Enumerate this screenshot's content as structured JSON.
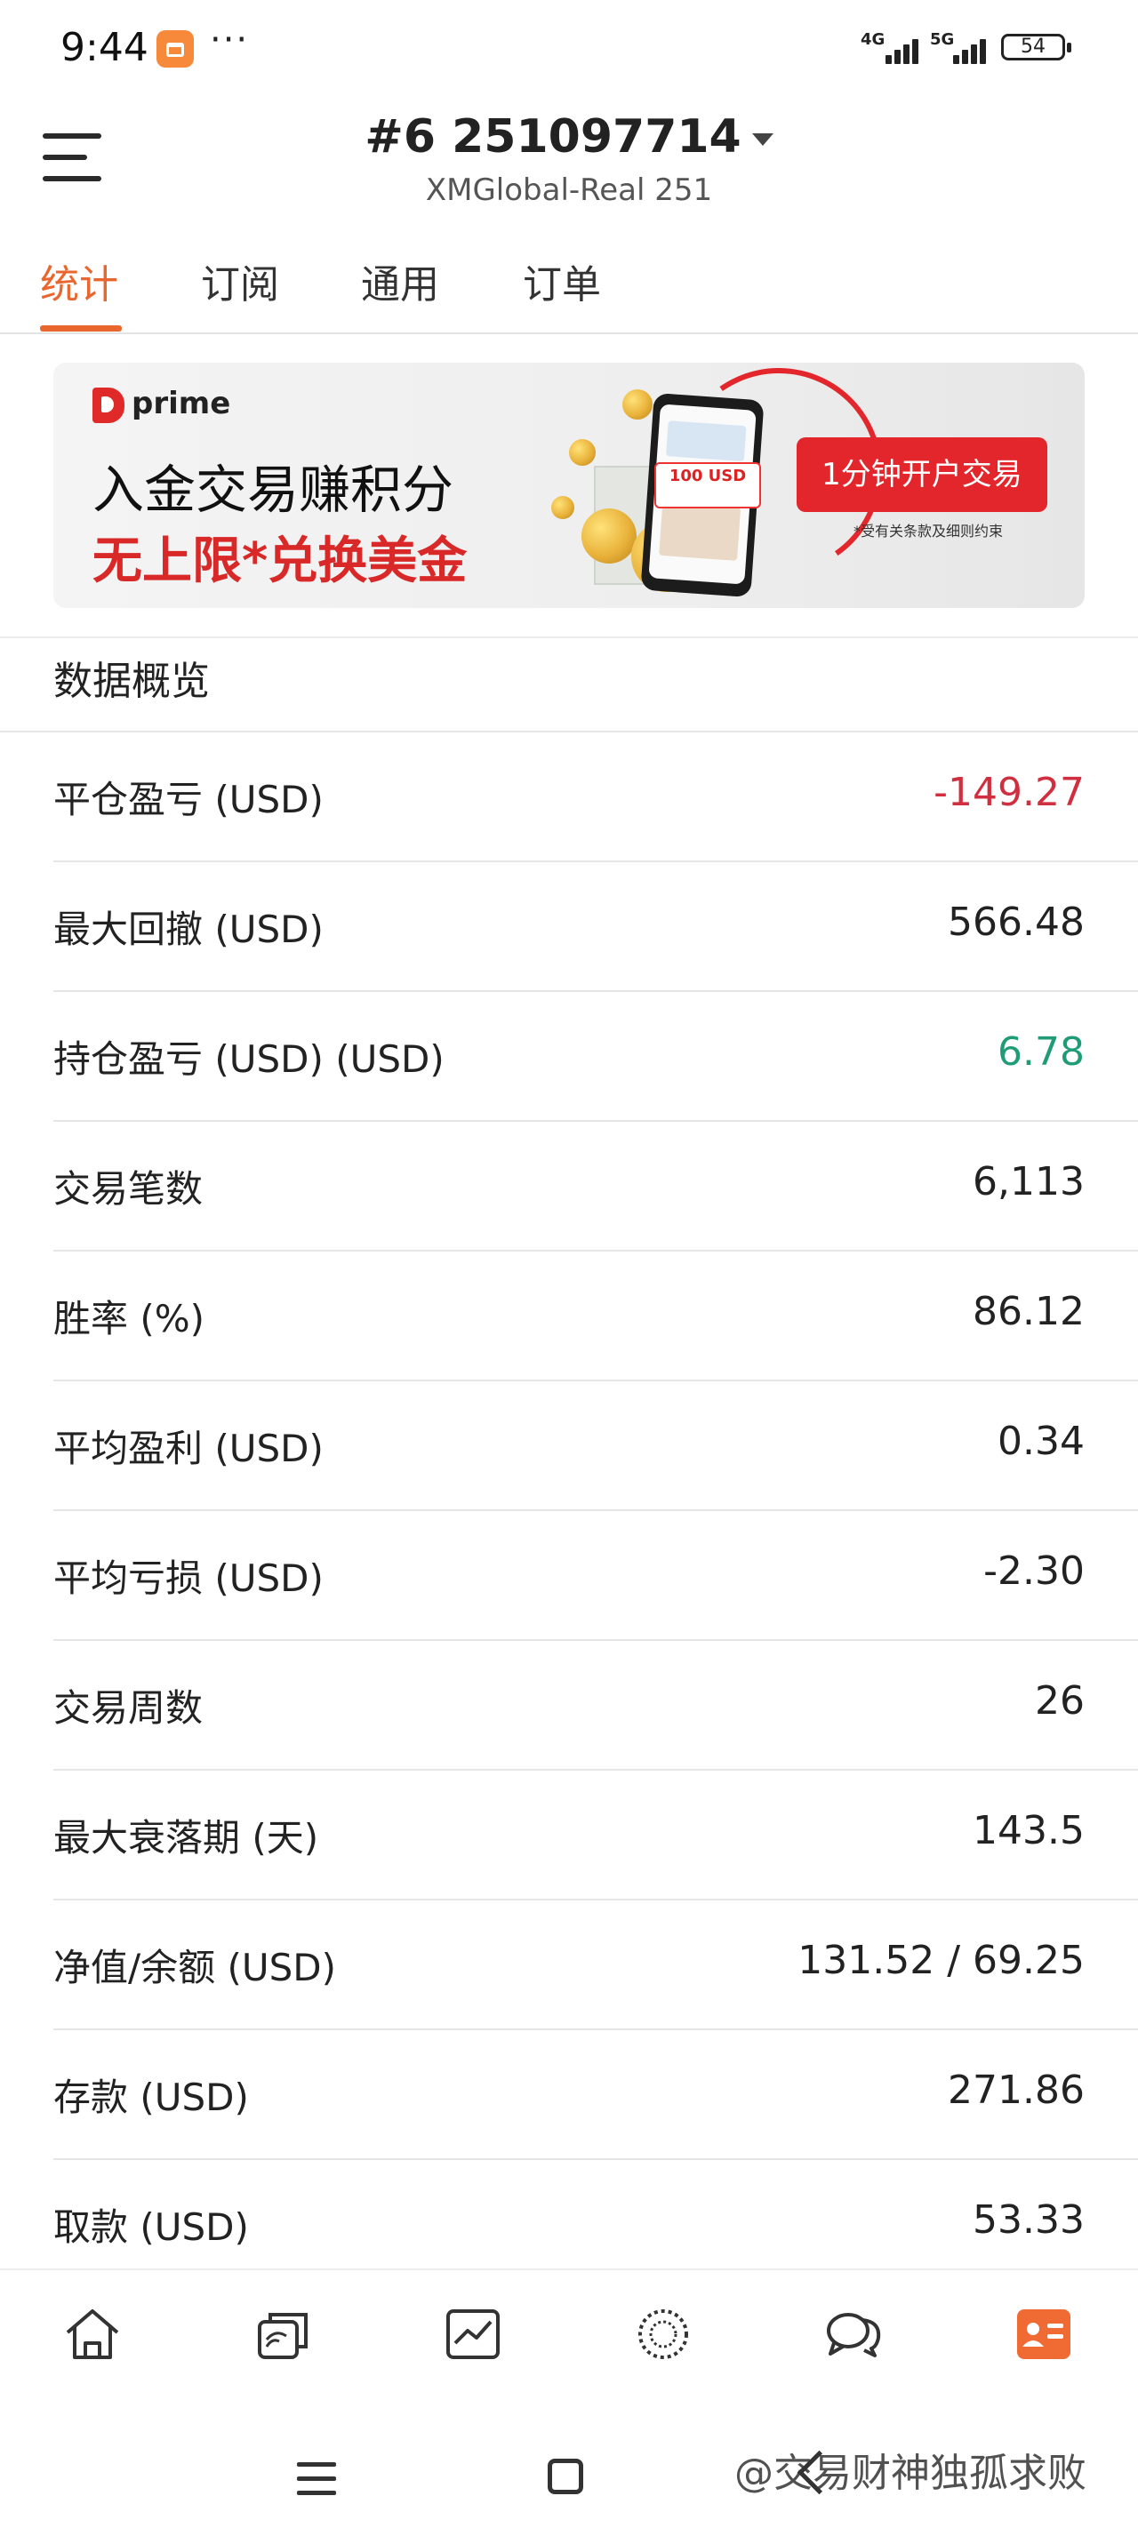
{
  "status_bar": {
    "time": "9:44",
    "more": "···",
    "network_1": "4G",
    "network_2": "5G",
    "battery": "54"
  },
  "header": {
    "account_title": "#6  251097714",
    "server": "XMGlobal-Real 251"
  },
  "tabs": [
    {
      "label": "统计",
      "active": true
    },
    {
      "label": "订阅",
      "active": false
    },
    {
      "label": "通用",
      "active": false
    },
    {
      "label": "订单",
      "active": false
    }
  ],
  "banner": {
    "brand": "prime",
    "headline": "入金交易赚积分",
    "subheadline": "无上限*兑换美金",
    "tag": "100 USD",
    "cta": "1分钟开户交易",
    "note": "*受有关条款及细则约束"
  },
  "section_title": "数据概览",
  "stats": [
    {
      "label": "平仓盈亏 (USD)",
      "value": "-149.27",
      "tone": "neg"
    },
    {
      "label": "最大回撤 (USD)",
      "value": "566.48",
      "tone": "normal"
    },
    {
      "label": "持仓盈亏 (USD) (USD)",
      "value": "6.78",
      "tone": "pos"
    },
    {
      "label": "交易笔数",
      "value": "6,113",
      "tone": "normal"
    },
    {
      "label": "胜率 (%)",
      "value": "86.12",
      "tone": "normal"
    },
    {
      "label": "平均盈利 (USD)",
      "value": "0.34",
      "tone": "normal"
    },
    {
      "label": "平均亏损 (USD)",
      "value": "-2.30",
      "tone": "normal"
    },
    {
      "label": "交易周数",
      "value": "26",
      "tone": "normal"
    },
    {
      "label": "最大衰落期 (天)",
      "value": "143.5",
      "tone": "normal"
    },
    {
      "label": "净值/余额 (USD)",
      "value": "131.52 / 69.25",
      "tone": "normal"
    },
    {
      "label": "存款 (USD)",
      "value": "271.86",
      "tone": "normal"
    },
    {
      "label": "取款 (USD)",
      "value": "53.33",
      "tone": "normal"
    }
  ],
  "bottom_nav": [
    {
      "icon": "home-icon",
      "active": false
    },
    {
      "icon": "copy-trade-icon",
      "active": false
    },
    {
      "icon": "chart-icon",
      "active": false
    },
    {
      "icon": "community-icon",
      "active": false
    },
    {
      "icon": "chat-icon",
      "active": false
    },
    {
      "icon": "profile-card-icon",
      "active": true
    }
  ],
  "colors": {
    "accent": "#e9662f",
    "negative": "#cf2f3f",
    "positive": "#1f9c75",
    "banner_red": "#e3262b"
  },
  "watermark": "@交易财神独孤求败"
}
